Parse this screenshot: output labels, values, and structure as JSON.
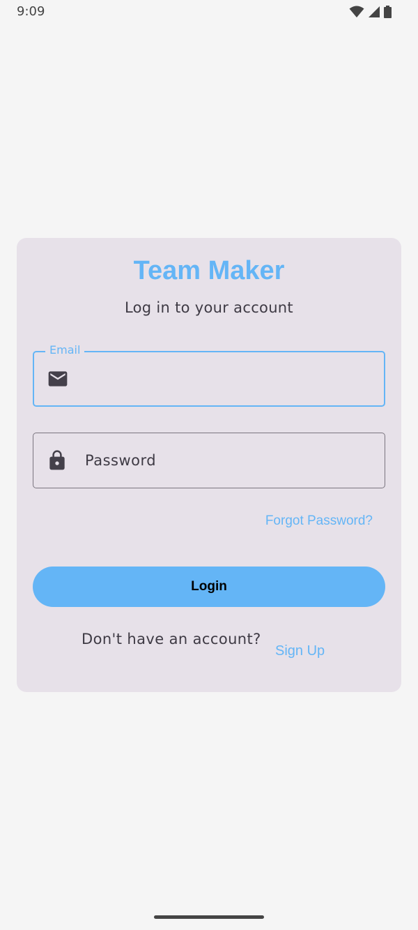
{
  "status_bar": {
    "time": "9:09",
    "icons": [
      "wifi-icon",
      "cell-signal-icon",
      "battery-icon"
    ]
  },
  "login_card": {
    "title": "Team Maker",
    "subtitle": "Log in to your account",
    "email_field": {
      "label": "Email",
      "value": "",
      "icon": "mail-icon"
    },
    "password_field": {
      "placeholder": "Password",
      "value": "",
      "icon": "lock-icon"
    },
    "forgot_password": "Forgot Password?",
    "login_button": "Login",
    "no_account_text": "Don't have an account?",
    "sign_up": "Sign Up"
  },
  "colors": {
    "accent": "#64b5f6",
    "card_background": "#e7e1e9",
    "page_background": "#f5f5f5",
    "text": "#3e3a44"
  }
}
